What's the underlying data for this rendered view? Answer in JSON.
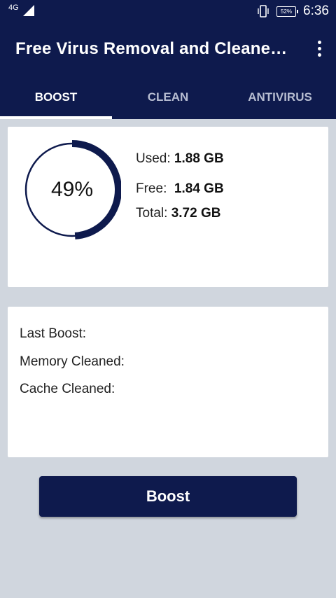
{
  "status_bar": {
    "network": "4G",
    "battery": "52%",
    "time": "6:36",
    "icons": [
      "signal-icon",
      "vibrate-icon",
      "battery-icon"
    ]
  },
  "app_bar": {
    "title": "Free Virus Removal and Cleane…",
    "menu_icon": "more-vert-icon"
  },
  "tabs": [
    {
      "label": "BOOST",
      "active": true
    },
    {
      "label": "CLEAN",
      "active": false
    },
    {
      "label": "ANTIVIRUS",
      "active": false
    }
  ],
  "memory": {
    "percent_label": "49%",
    "percent_value": 49,
    "used_label": "Used:",
    "used_value": "1.88 GB",
    "free_label": "Free:",
    "free_value": "1.84 GB",
    "total_label": "Total:",
    "total_value": "3.72 GB"
  },
  "stats": {
    "last_boost": "Last Boost:",
    "memory_cleaned": "Memory Cleaned:",
    "cache_cleaned": "Cache Cleaned:"
  },
  "boost_button": "Boost",
  "colors": {
    "primary": "#0e1a4d",
    "background": "#d0d6de",
    "card": "#ffffff"
  }
}
